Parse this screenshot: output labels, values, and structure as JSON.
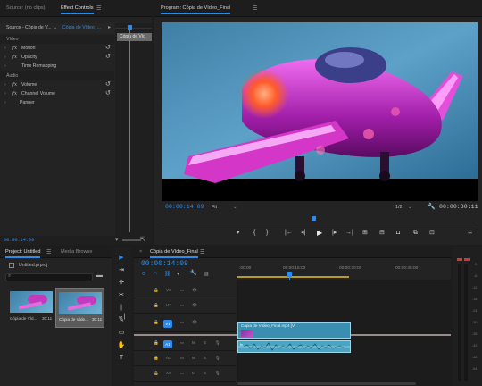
{
  "source_panel": {
    "tab_source": "Source: (no clips)",
    "tab_effect_controls": "Effect Controls",
    "menu_icon": "hamburger-icon",
    "source_select": "Source - Cópia de V...",
    "clip_select": "Cópia de Vídeo_...",
    "mini_clip_label": "Cópia de Víd",
    "sections": [
      {
        "label": "Vídeo",
        "rows": [
          {
            "fx": "fx",
            "label": "Motion"
          },
          {
            "fx": "fx",
            "label": "Opacity"
          },
          {
            "fx": "",
            "label": "Time Remapping"
          }
        ]
      },
      {
        "label": "Áudio",
        "rows": [
          {
            "fx": "fx",
            "label": "Volume"
          },
          {
            "fx": "fx",
            "label": "Channel Volume"
          },
          {
            "fx": "",
            "label": "Panner"
          }
        ]
      }
    ],
    "timecode": "00:00:14:09"
  },
  "program_panel": {
    "title": "Program: Cópia de Vídeo_Final",
    "timecode_current": "00:00:14:09",
    "fit_label": "Fit",
    "resolution": "1/2",
    "timecode_duration": "00:00:30:11",
    "transport_icons": [
      "marker-icon",
      "in-point-icon",
      "out-point-icon",
      "go-to-in-icon",
      "step-back-icon",
      "play-icon",
      "step-forward-icon",
      "go-to-out-icon",
      "insert-icon",
      "overwrite-icon",
      "export-frame-icon",
      "comparison-view-icon",
      "button-editor-icon"
    ]
  },
  "project_panel": {
    "tab_project": "Project: Untitled",
    "tab_media_browser": "Media Browse",
    "project_file": "Untitled.prproj",
    "search_placeholder": "",
    "items": [
      {
        "name": "Cópia de Víd...",
        "duration": "30:11"
      },
      {
        "name": "Cópia de Víde...",
        "duration": "30:11"
      }
    ]
  },
  "timeline_panel": {
    "tab_label": "Cópia de Vídeo_Final",
    "timecode": "00:00:14:09",
    "ruler_labels": [
      ":00:00",
      "00:00:15:00",
      "00:00:30:00",
      "00:00:45:00"
    ],
    "tracks": [
      {
        "id": "V3",
        "kind": "video"
      },
      {
        "id": "V2",
        "kind": "video"
      },
      {
        "id": "V1",
        "kind": "video"
      },
      {
        "id": "A1",
        "kind": "audio"
      },
      {
        "id": "A2",
        "kind": "audio"
      },
      {
        "id": "A3",
        "kind": "audio"
      }
    ],
    "video_clip_label": "Cópia de Vídeo_Final.mp4 [V]",
    "track_button_m": "M",
    "track_button_s": "S",
    "track_button_v1": "V1"
  },
  "audio_meter": {
    "scale": [
      "0",
      "-6",
      "-12",
      "-18",
      "-24",
      "-30",
      "-36",
      "-42",
      "-48",
      "-54"
    ]
  },
  "colors": {
    "accent": "#2d8ceb",
    "clip_video": "#3a8fb0",
    "clip_audio": "#4aa5c4",
    "panel_bg": "#232323"
  }
}
